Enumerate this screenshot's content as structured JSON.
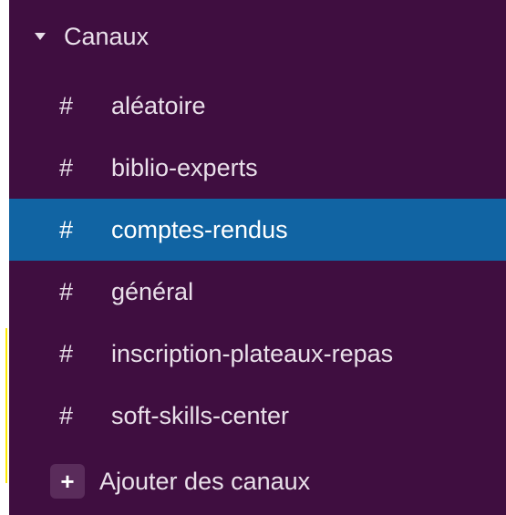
{
  "section": {
    "title": "Canaux",
    "caret_icon": "caret-down-icon"
  },
  "channels": [
    {
      "prefix": "#",
      "name": "aléatoire",
      "active": false
    },
    {
      "prefix": "#",
      "name": "biblio-experts",
      "active": false
    },
    {
      "prefix": "#",
      "name": "comptes-rendus",
      "active": true
    },
    {
      "prefix": "#",
      "name": "général",
      "active": false
    },
    {
      "prefix": "#",
      "name": "inscription-plateaux-repas",
      "active": false
    },
    {
      "prefix": "#",
      "name": "soft-skills-center",
      "active": false
    }
  ],
  "add_channels": {
    "icon": "+",
    "label": "Ajouter des canaux"
  },
  "colors": {
    "sidebar_bg": "#3f0e40",
    "active_bg": "#1164a3",
    "text": "#e9e0ea",
    "highlight_border": "#ffea00"
  }
}
